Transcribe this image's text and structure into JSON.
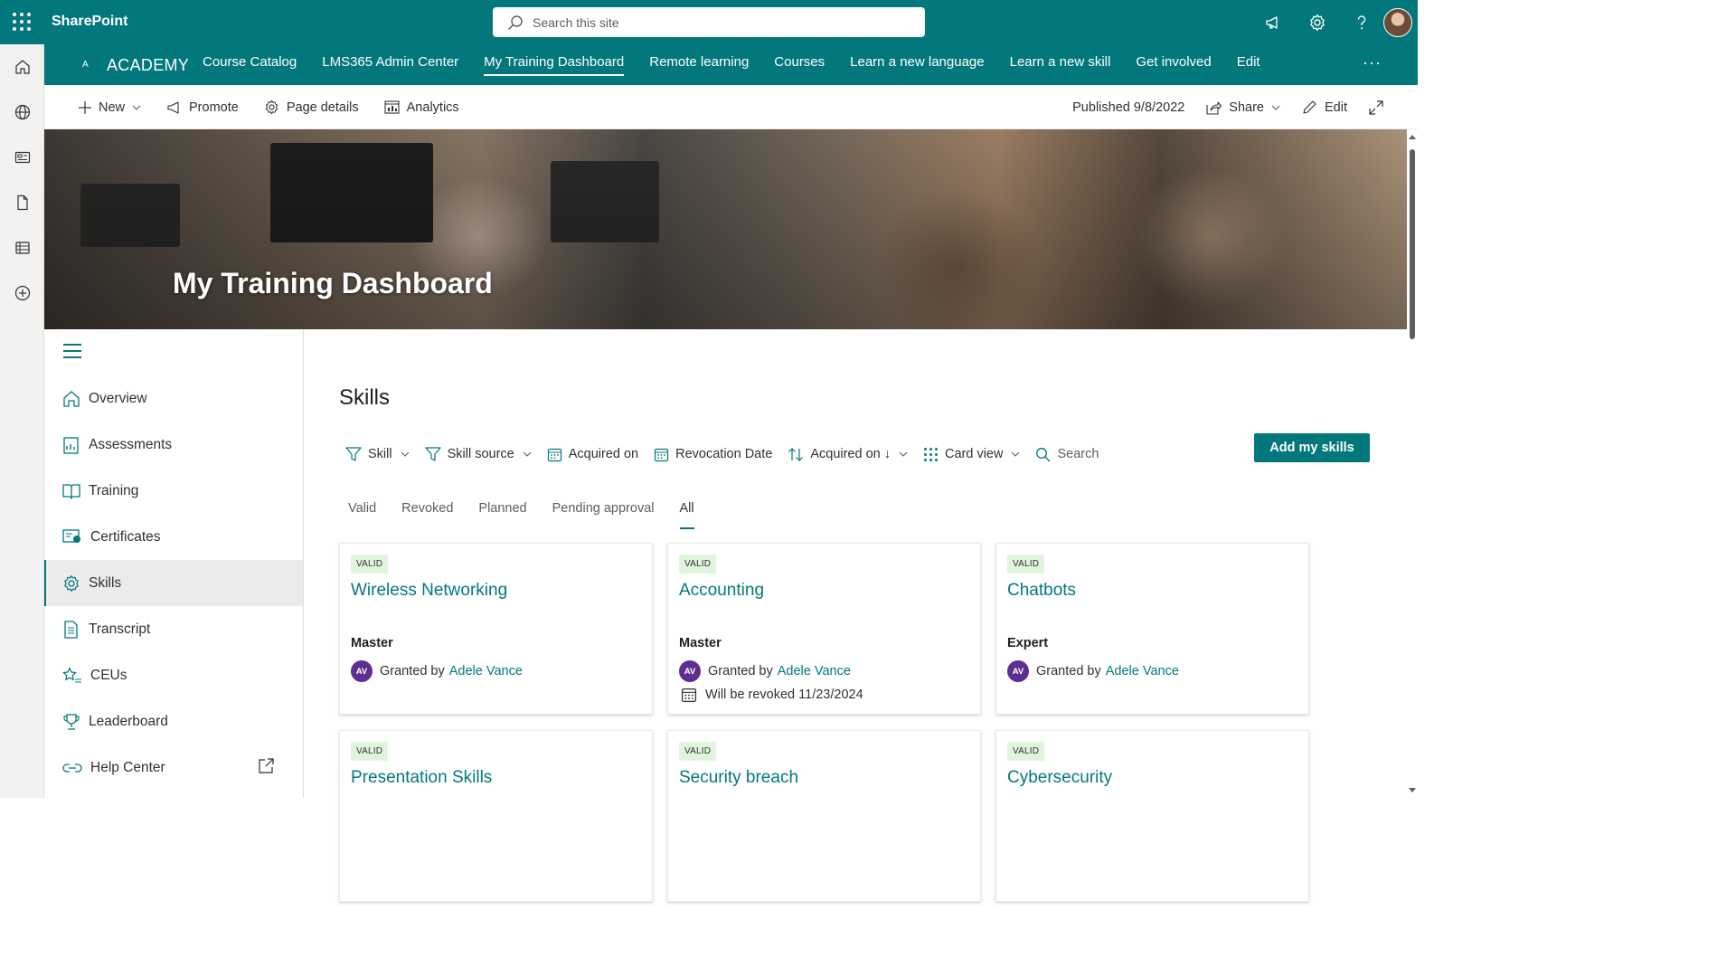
{
  "suitebar": {
    "brand": "SharePoint",
    "search_placeholder": "Search this site"
  },
  "hub": {
    "logo": "A",
    "title": "ACADEMY",
    "links": [
      "Course Catalog",
      "LMS365 Admin Center",
      "My Training Dashboard",
      "Remote learning",
      "Courses",
      "Learn a new language",
      "Learn a new skill",
      "Get involved",
      "Edit"
    ],
    "active_link": "My Training Dashboard",
    "more": "···"
  },
  "commandbar": {
    "new": "New",
    "promote": "Promote",
    "page_details": "Page details",
    "analytics": "Analytics",
    "published": "Published 9/8/2022",
    "share": "Share",
    "edit": "Edit"
  },
  "banner": {
    "title": "My Training Dashboard"
  },
  "leftnav": {
    "items": [
      {
        "label": "Overview",
        "icon": "home-icon"
      },
      {
        "label": "Assessments",
        "icon": "assessment-icon"
      },
      {
        "label": "Training",
        "icon": "book-icon"
      },
      {
        "label": "Certificates",
        "icon": "certificate-icon"
      },
      {
        "label": "Skills",
        "icon": "skills-gear-icon",
        "active": true
      },
      {
        "label": "Transcript",
        "icon": "transcript-icon"
      },
      {
        "label": "CEUs",
        "icon": "star-list-icon"
      },
      {
        "label": "Leaderboard",
        "icon": "trophy-icon"
      },
      {
        "label": "Help Center",
        "icon": "link-icon"
      }
    ]
  },
  "skills": {
    "title": "Skills",
    "toolbar": {
      "skill": "Skill",
      "skill_source": "Skill source",
      "acquired_on": "Acquired on",
      "revocation_date": "Revocation Date",
      "sort": "Acquired on ↓",
      "view": "Card view",
      "search": "Search"
    },
    "add_button": "Add my skills",
    "tabs": [
      "Valid",
      "Revoked",
      "Planned",
      "Pending approval",
      "All"
    ],
    "active_tab": "All",
    "cards": [
      {
        "status": "VALID",
        "title": "Wireless Networking",
        "level": "Master",
        "granted_prefix": "Granted by",
        "initials": "AV",
        "granted_by": "Adele Vance"
      },
      {
        "status": "VALID",
        "title": "Accounting",
        "level": "Master",
        "granted_prefix": "Granted by",
        "initials": "AV",
        "granted_by": "Adele Vance",
        "revoke": "Will be revoked 11/23/2024"
      },
      {
        "status": "VALID",
        "title": "Chatbots",
        "level": "Expert",
        "granted_prefix": "Granted by",
        "initials": "AV",
        "granted_by": "Adele Vance"
      },
      {
        "status": "VALID",
        "title": "Presentation Skills"
      },
      {
        "status": "VALID",
        "title": "Security breach"
      },
      {
        "status": "VALID",
        "title": "Cybersecurity"
      }
    ]
  },
  "colors": {
    "brand_teal": "#03787c",
    "valid_badge": "#dff6dd",
    "avatar_purple": "#5c2e91"
  }
}
